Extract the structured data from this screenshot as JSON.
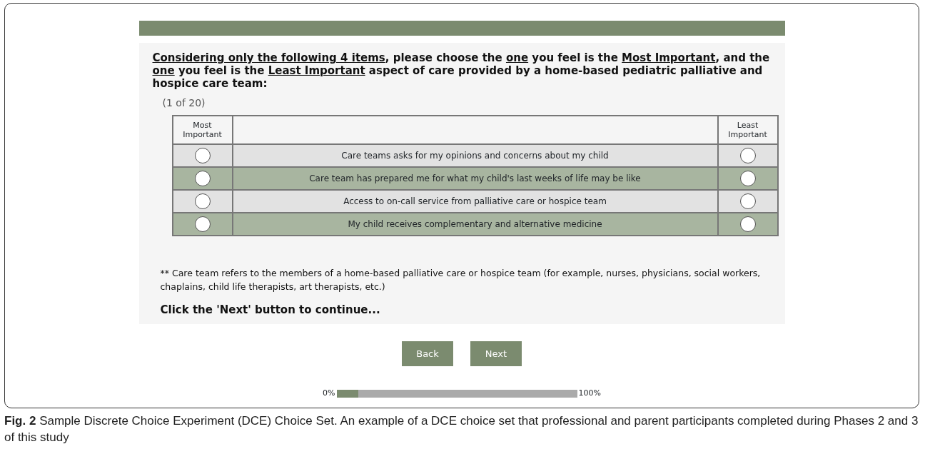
{
  "question": [
    {
      "text": "Considering only the following 4 items",
      "underline": true
    },
    {
      "text": ", please choose the ",
      "underline": false
    },
    {
      "text": "one",
      "underline": true
    },
    {
      "text": " you feel is the ",
      "underline": false
    },
    {
      "text": "Most Important",
      "underline": true
    },
    {
      "text": ", and the ",
      "underline": false
    },
    {
      "text": "one",
      "underline": true
    },
    {
      "text": " you feel is the ",
      "underline": false
    },
    {
      "text": "Least Important",
      "underline": true
    },
    {
      "text": " aspect of care provided by a home-based pediatric palliative and hospice care team:",
      "underline": false
    }
  ],
  "counter": "(1 of 20)",
  "table": {
    "columns": [
      "Most Important",
      "Least Important"
    ],
    "rows": [
      {
        "text": "Care teams asks for my opinions and concerns about my child",
        "most_selected": false,
        "least_selected": false
      },
      {
        "text": "Care team has prepared me for what my child's last weeks of life may be like",
        "most_selected": false,
        "least_selected": false
      },
      {
        "text": "Access to on-call service from palliative care or hospice team",
        "most_selected": false,
        "least_selected": false
      },
      {
        "text": "My child receives complementary and alternative medicine",
        "most_selected": false,
        "least_selected": false
      }
    ]
  },
  "footnote": "** Care team refers to the members of a home-based palliative care or hospice team (for example, nurses, physicians, social workers, chaplains, child life therapists, art therapists, etc.)",
  "instruction": "Click the 'Next' button to continue...",
  "buttons": [
    "Back",
    "Next"
  ],
  "progress": {
    "start_label": "0%",
    "end_label": "100%",
    "level": 0.09
  },
  "caption": "**Fig. 2** Sample Discrete Choice Experiment (DCE) Choice Set. An example of a DCE choice set that professional and parent participants completed during Phases 2 and 3 of this study"
}
